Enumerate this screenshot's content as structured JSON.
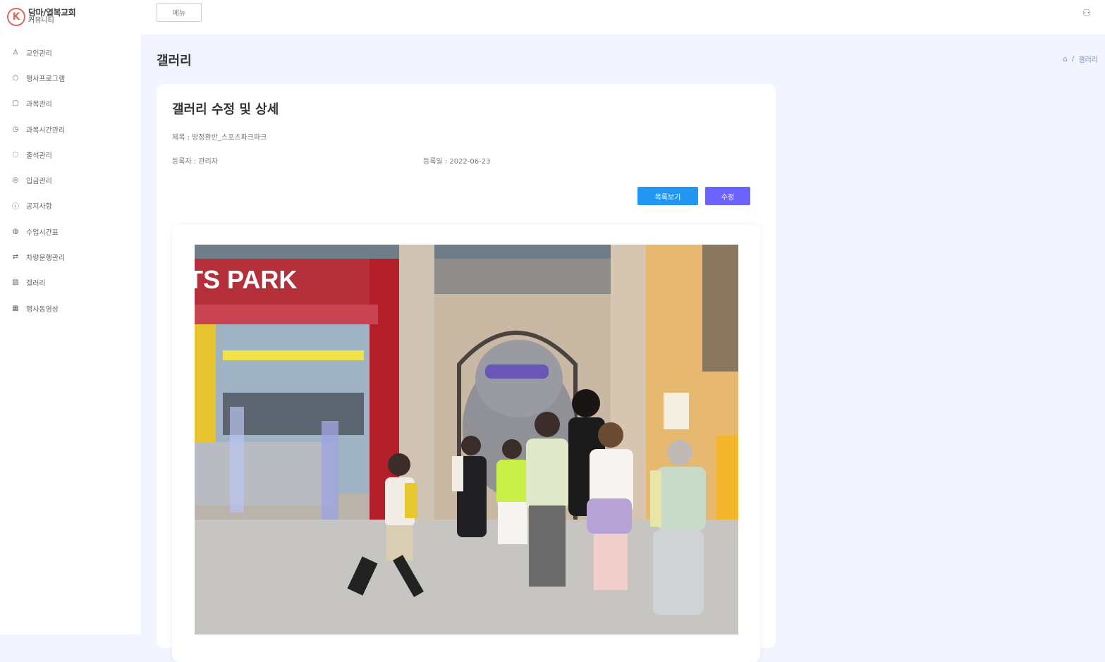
{
  "brand": {
    "mark": "K",
    "line1": "담마/열복교회",
    "line2": "커뮤니티"
  },
  "sidebar": {
    "items": [
      {
        "icon": "user-icon",
        "glyph": "♙",
        "label": "교인관리"
      },
      {
        "icon": "circle-icon",
        "glyph": "○",
        "label": "행사프로그램"
      },
      {
        "icon": "calendar-icon",
        "glyph": "▢",
        "label": "과목관리"
      },
      {
        "icon": "clock-icon",
        "glyph": "◷",
        "label": "과목시간관리"
      },
      {
        "icon": "check-icon",
        "glyph": "◌",
        "label": "출석관리"
      },
      {
        "icon": "badge-icon",
        "glyph": "◎",
        "label": "입금관리"
      },
      {
        "icon": "info-icon",
        "glyph": "ⓘ",
        "label": "공지사항"
      },
      {
        "icon": "shield-icon",
        "glyph": "◍",
        "label": "수업시간표"
      },
      {
        "icon": "swap-icon",
        "glyph": "⇄",
        "label": "차량운행관리"
      },
      {
        "icon": "image-icon",
        "glyph": "▨",
        "label": "갤러리"
      },
      {
        "icon": "grid-icon",
        "glyph": "▦",
        "label": "행사동영상"
      }
    ]
  },
  "topbar": {
    "menu_label": "메뉴",
    "user_icon": "user-circle-icon"
  },
  "page": {
    "title": "갤러리",
    "breadcrumb_current": "갤러리",
    "breadcrumb_sep": "/"
  },
  "card": {
    "title": "갤러리 수정 및 상세",
    "post_title": "제목 : 방정환반_스포츠파크파크",
    "author": "등록자 : 관리자",
    "date": "등록일 : 2022-06-23",
    "list_button": "목록보기",
    "edit_button": "수정"
  },
  "photo": {
    "sign_text": "TS PARK"
  }
}
